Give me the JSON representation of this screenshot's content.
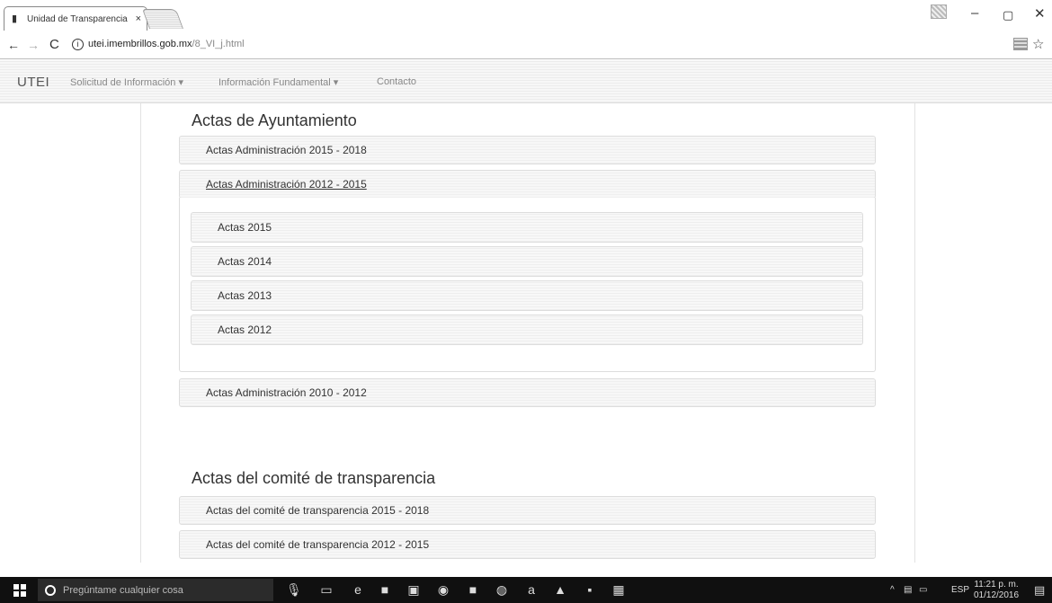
{
  "browser": {
    "tab_title": "Unidad de Transparencia",
    "tab_close": "×",
    "url_host": "utei.imembrillos.gob.mx",
    "url_path": "/8_VI_j.html",
    "back": "←",
    "forward": "→",
    "reload": "C",
    "info": "i",
    "star": "☆",
    "menu": "⋮",
    "minimize": "–",
    "maximize": "▢",
    "close": "✕"
  },
  "navbar": {
    "brand": "UTEI",
    "items": [
      {
        "label": "Solicitud de Información ▾"
      },
      {
        "label": "Información Fundamental ▾"
      },
      {
        "label": "Contacto"
      }
    ]
  },
  "sections": [
    {
      "title": "Actas de Ayuntamiento",
      "panels": [
        {
          "label": "Actas Administración 2015 - 2018"
        },
        {
          "label": "Actas Administración 2012 - 2015",
          "children": [
            {
              "label": "Actas 2015"
            },
            {
              "label": "Actas 2014"
            },
            {
              "label": "Actas 2013"
            },
            {
              "label": "Actas 2012"
            }
          ]
        },
        {
          "label": "Actas Administración 2010 - 2012"
        }
      ]
    },
    {
      "title": "Actas del comité de transparencia",
      "panels": [
        {
          "label": "Actas del comité de transparencia 2015 - 2018"
        },
        {
          "label": "Actas del comité de transparencia 2012 - 2015"
        }
      ]
    }
  ],
  "taskbar": {
    "search_placeholder": "Pregúntame cualquier cosa",
    "tray_lang": "ESP",
    "tray_chevron": "^",
    "time": "11:21 p. m.",
    "date": "01/12/2016",
    "icons": [
      "microphone-icon",
      "task-view-icon",
      "edge-icon",
      "file-explorer-icon",
      "store-icon",
      "chrome-icon",
      "app-icon",
      "spotify-icon",
      "amazon-icon",
      "home-icon",
      "photos-icon",
      "notepad-icon"
    ]
  }
}
